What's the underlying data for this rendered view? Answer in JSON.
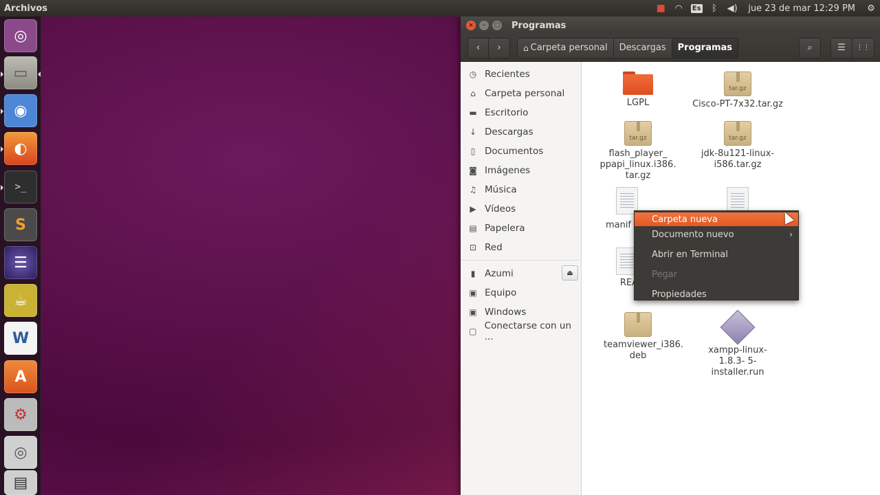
{
  "top_panel": {
    "app_title": "Archivos",
    "clock": "jue 23 de mar 12:29 PM",
    "keyboard_layout": "Es",
    "tray_icons": [
      "record-icon",
      "wifi-icon",
      "keyboard-icon",
      "bluetooth-icon",
      "volume-icon",
      "clock",
      "gear-icon"
    ]
  },
  "launcher": {
    "items": [
      {
        "name": "dash-home",
        "icon": "ubuntu-logo-icon",
        "color": "#8a4a8a"
      },
      {
        "name": "files",
        "icon": "file-cabinet-icon",
        "color": "#8c8c82"
      },
      {
        "name": "chromium",
        "icon": "chromium-icon",
        "color": "#4e86d6"
      },
      {
        "name": "firefox",
        "icon": "firefox-icon",
        "color": "#e5622a"
      },
      {
        "name": "terminal",
        "icon": "terminal-icon",
        "color": "#2e2e2e"
      },
      {
        "name": "sublime-text",
        "icon": "sublime-icon",
        "color": "#4a4a4a"
      },
      {
        "name": "eclipse",
        "icon": "eclipse-icon",
        "color": "#3b2b6b"
      },
      {
        "name": "teapot",
        "icon": "teapot-icon",
        "color": "#d9c43a"
      },
      {
        "name": "libreoffice-writer",
        "icon": "writer-icon",
        "color": "#2d5c9a"
      },
      {
        "name": "software-center",
        "icon": "shopping-bag-icon",
        "color": "#e06b2a"
      },
      {
        "name": "system-settings",
        "icon": "settings-icon",
        "color": "#777777"
      },
      {
        "name": "disks",
        "icon": "disk-icon",
        "color": "#999999"
      }
    ],
    "sublime_glyph": "S",
    "writer_glyph": "W",
    "terminal_glyph": ">_",
    "store_glyph": "A"
  },
  "window": {
    "title": "Programas",
    "toolbar": {
      "breadcrumbs": [
        "Carpeta personal",
        "Descargas",
        "Programas"
      ],
      "active_crumb": "Programas",
      "back_icon": "‹",
      "forward_icon": "›",
      "search_icon": "⌕",
      "list_view_icon": "☰",
      "grid_view_icon": "⋮⋮"
    },
    "sidebar": {
      "places": [
        {
          "label": "Recientes",
          "icon": "clock-icon",
          "glyph": "◷"
        },
        {
          "label": "Carpeta personal",
          "icon": "home-icon",
          "glyph": "⌂"
        },
        {
          "label": "Escritorio",
          "icon": "desktop-icon",
          "glyph": "▬"
        },
        {
          "label": "Descargas",
          "icon": "download-icon",
          "glyph": "↓"
        },
        {
          "label": "Documentos",
          "icon": "document-icon",
          "glyph": "▯"
        },
        {
          "label": "Imágenes",
          "icon": "camera-icon",
          "glyph": "◙"
        },
        {
          "label": "Música",
          "icon": "music-icon",
          "glyph": "♫"
        },
        {
          "label": "Vídeos",
          "icon": "video-icon",
          "glyph": "▶"
        },
        {
          "label": "Papelera",
          "icon": "trash-icon",
          "glyph": "▤"
        },
        {
          "label": "Red",
          "icon": "network-icon",
          "glyph": "⊡"
        }
      ],
      "devices": [
        {
          "label": "Azumi",
          "icon": "usb-drive-icon",
          "glyph": "▮"
        },
        {
          "label": "Equipo",
          "icon": "drive-icon",
          "glyph": "▣"
        },
        {
          "label": "Windows",
          "icon": "drive-icon",
          "glyph": "▣"
        },
        {
          "label": "Conectarse con un ...",
          "icon": "connect-server-icon",
          "glyph": "▢"
        }
      ],
      "eject_glyph": "⏏"
    },
    "files": [
      {
        "name": "LGPL",
        "type": "folder"
      },
      {
        "name": "Cisco-PT-7x32.tar.gz",
        "type": "archive"
      },
      {
        "name": "flash_player_ ppapi_linux.i386. tar.gz",
        "type": "archive"
      },
      {
        "name": "jdk-8u121-linux- i586.tar.gz",
        "type": "archive"
      },
      {
        "name": "manif",
        "type": "document"
      },
      {
        "name": "",
        "type": "document"
      },
      {
        "name": "REA",
        "type": "document"
      },
      {
        "name": "teamviewer_i386. deb",
        "type": "package"
      },
      {
        "name": "xampp-linux-1.8.3- 5-installer.run",
        "type": "executable"
      }
    ],
    "archive_label": "tar.gz"
  },
  "context_menu": {
    "items": [
      {
        "label": "Carpeta nueva",
        "state": "highlighted"
      },
      {
        "label": "Documento nuevo",
        "state": "submenu"
      },
      {
        "label": "Abrir en Terminal",
        "state": "normal"
      },
      {
        "label": "Pegar",
        "state": "disabled"
      },
      {
        "label": "Propiedades",
        "state": "normal"
      }
    ],
    "submenu_arrow": "›"
  },
  "colors": {
    "accent": "#e95420",
    "panel": "#3c3b37",
    "sidebar": "#f5f4f3"
  }
}
